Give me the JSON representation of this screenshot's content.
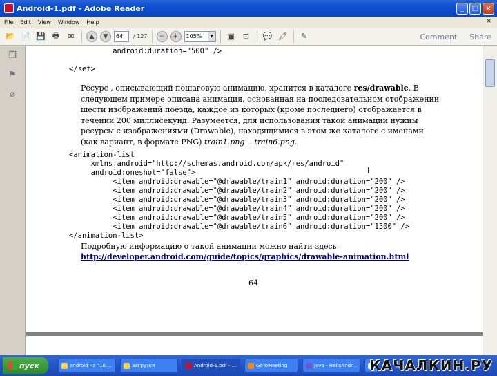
{
  "window": {
    "title": "Android-1.pdf - Adobe Reader",
    "close_glyph": "×"
  },
  "menu": [
    "File",
    "Edit",
    "View",
    "Window",
    "Help"
  ],
  "toolbar": {
    "page_current": "64",
    "page_total": "/ 127",
    "zoom": "105%",
    "comment": "Comment",
    "share": "Share"
  },
  "document": {
    "code_top": "          android:duration=\"500\" />",
    "set_close": "</set>",
    "paragraph": {
      "t1": "Ресурс , описывающий пошаговую анимацию, хранится в каталоге ",
      "b1": "res/drawable",
      "t2": ". В следующем примере описана анимация, основанная на последовательном отображении шести изображений поезда, каждое из которых (кроме последнего) отображается в течении 200 миллисекунд. Разумеется, для использования такой анимации нужны ресурсы с изображениями (Drawable), находящимися в этом же каталоге с именами (как вариант, в формате PNG) ",
      "i1": "train1.png .. train6.png",
      "t3": "."
    },
    "code_lines": [
      "<animation-list",
      "     xmlns:android=\"http://schemas.android.com/apk/res/android\"",
      "     android:oneshot=\"false\">",
      "          <item android:drawable=\"@drawable/train1\" android:duration=\"200\" />",
      "          <item android:drawable=\"@drawable/train2\" android:duration=\"200\" />",
      "          <item android:drawable=\"@drawable/train3\" android:duration=\"200\" />",
      "          <item android:drawable=\"@drawable/train4\" android:duration=\"200\" />",
      "          <item android:drawable=\"@drawable/train5\" android:duration=\"200\" />",
      "          <item android:drawable=\"@drawable/train6\" android:duration=\"1500\" />",
      "</animation-list>"
    ],
    "more_info": "Подробную информацию о такой анимации можно найти здесь:",
    "link": "http://developer.android.com/guide/topics/graphics/drawable-animation.html",
    "page_number": "64"
  },
  "taskbar": {
    "start": "пуск",
    "tasks": [
      {
        "label": "android на \"10...."
      },
      {
        "label": "Загрузки"
      },
      {
        "label": "Android-1.pdf - ..."
      },
      {
        "label": "GoToMeeting"
      },
      {
        "label": "Java - HelloAndr..."
      },
      {
        "label": ""
      }
    ],
    "watermark": "КАЧАЛКИН.РУ"
  }
}
